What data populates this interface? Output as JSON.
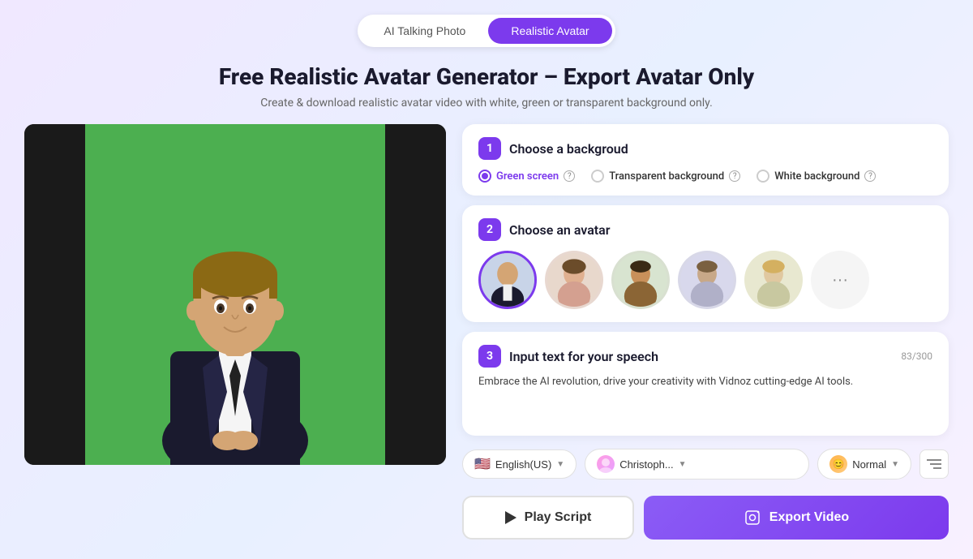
{
  "tabs": {
    "inactive": "AI Talking Photo",
    "active": "Realistic Avatar"
  },
  "hero": {
    "title": "Free Realistic Avatar Generator – Export Avatar Only",
    "subtitle": "Create & download realistic avatar video with white, green or transparent background only."
  },
  "step1": {
    "badge": "1",
    "title": "Choose a backgroud",
    "options": [
      {
        "id": "green",
        "label": "Green screen",
        "selected": true
      },
      {
        "id": "transparent",
        "label": "Transparent background",
        "selected": false
      },
      {
        "id": "white",
        "label": "White background",
        "selected": false
      }
    ]
  },
  "step2": {
    "badge": "2",
    "title": "Choose an avatar",
    "more_label": "···"
  },
  "step3": {
    "badge": "3",
    "title": "Input text for your speech",
    "char_count": "83/300",
    "text": "Embrace the AI revolution, drive your creativity with Vidnoz cutting-edge AI tools."
  },
  "controls": {
    "language": "English(US)",
    "voice": "Christoph...",
    "speed": "Normal",
    "flag": "🇺🇸"
  },
  "buttons": {
    "play_script": "Play Script",
    "export_video": "Export Video"
  }
}
